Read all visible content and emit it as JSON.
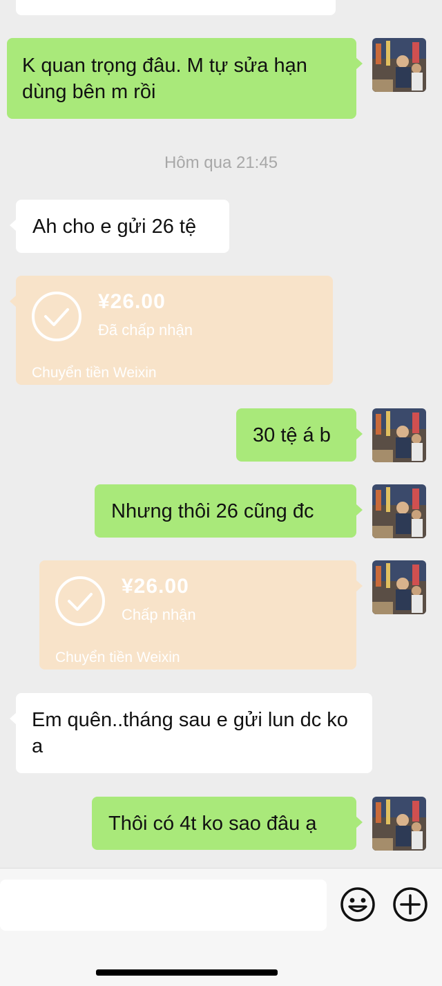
{
  "messages": {
    "m0_partial": "",
    "m1_out": "K quan trọng đâu. M tự sửa hạn dùng bên m rồi",
    "timestamp": "Hôm qua 21:45",
    "m2_in": "Ah cho e gửi 26 tệ",
    "transfer1": {
      "amount": "¥26.00",
      "status": "Đã chấp nhận",
      "footer": "Chuyển tiền Weixin"
    },
    "m3_out": "30 tệ á b",
    "m4_out": "Nhưng thôi 26 cũng đc",
    "transfer2": {
      "amount": "¥26.00",
      "status": "Chấp nhận",
      "footer": "Chuyển tiền Weixin"
    },
    "m5_in": "Em quên..tháng sau e gửi lun dc ko a",
    "m6_out": "Thôi có 4t ko sao đâu ạ"
  },
  "icons": {
    "emoji": "smiley-face-icon",
    "plus": "plus-circle-icon",
    "check": "check-circle-icon"
  },
  "colors": {
    "background": "#ededed",
    "outgoing_bubble": "#a9e97a",
    "incoming_bubble": "#ffffff",
    "transfer_bubble": "#f8e3c9"
  }
}
